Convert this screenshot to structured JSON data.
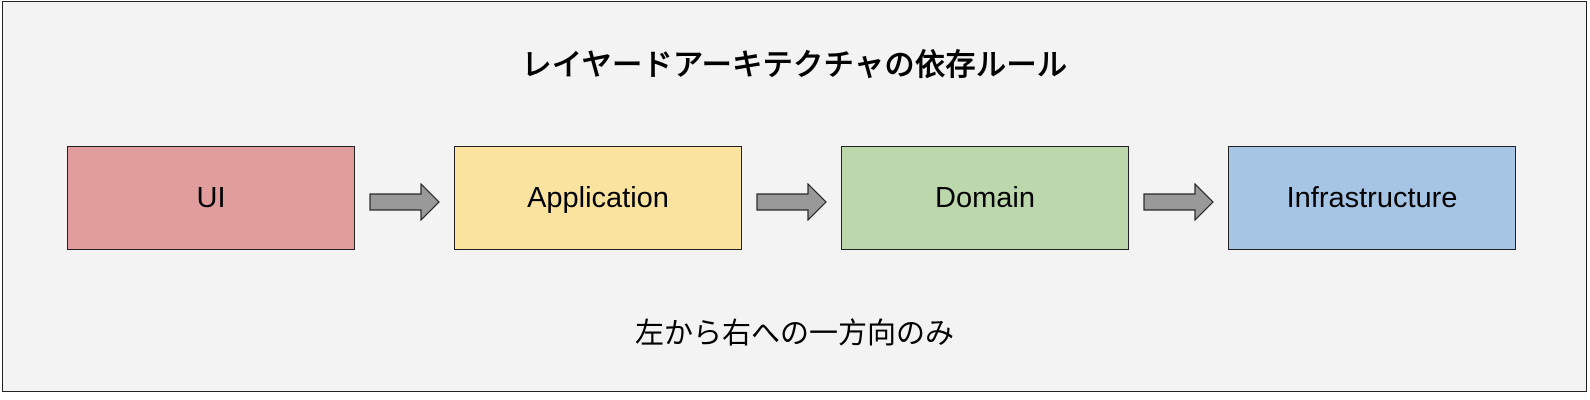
{
  "diagram": {
    "title": "レイヤードアーキテクチャの依存ルール",
    "layers": [
      {
        "label": "UI",
        "color": "#e09d9c"
      },
      {
        "label": "Application",
        "color": "#fae39e"
      },
      {
        "label": "Domain",
        "color": "#bdd7ad"
      },
      {
        "label": "Infrastructure",
        "color": "#a6c4e4"
      }
    ],
    "arrow_color": "#999999",
    "caption": "左から右への一方向のみ"
  }
}
